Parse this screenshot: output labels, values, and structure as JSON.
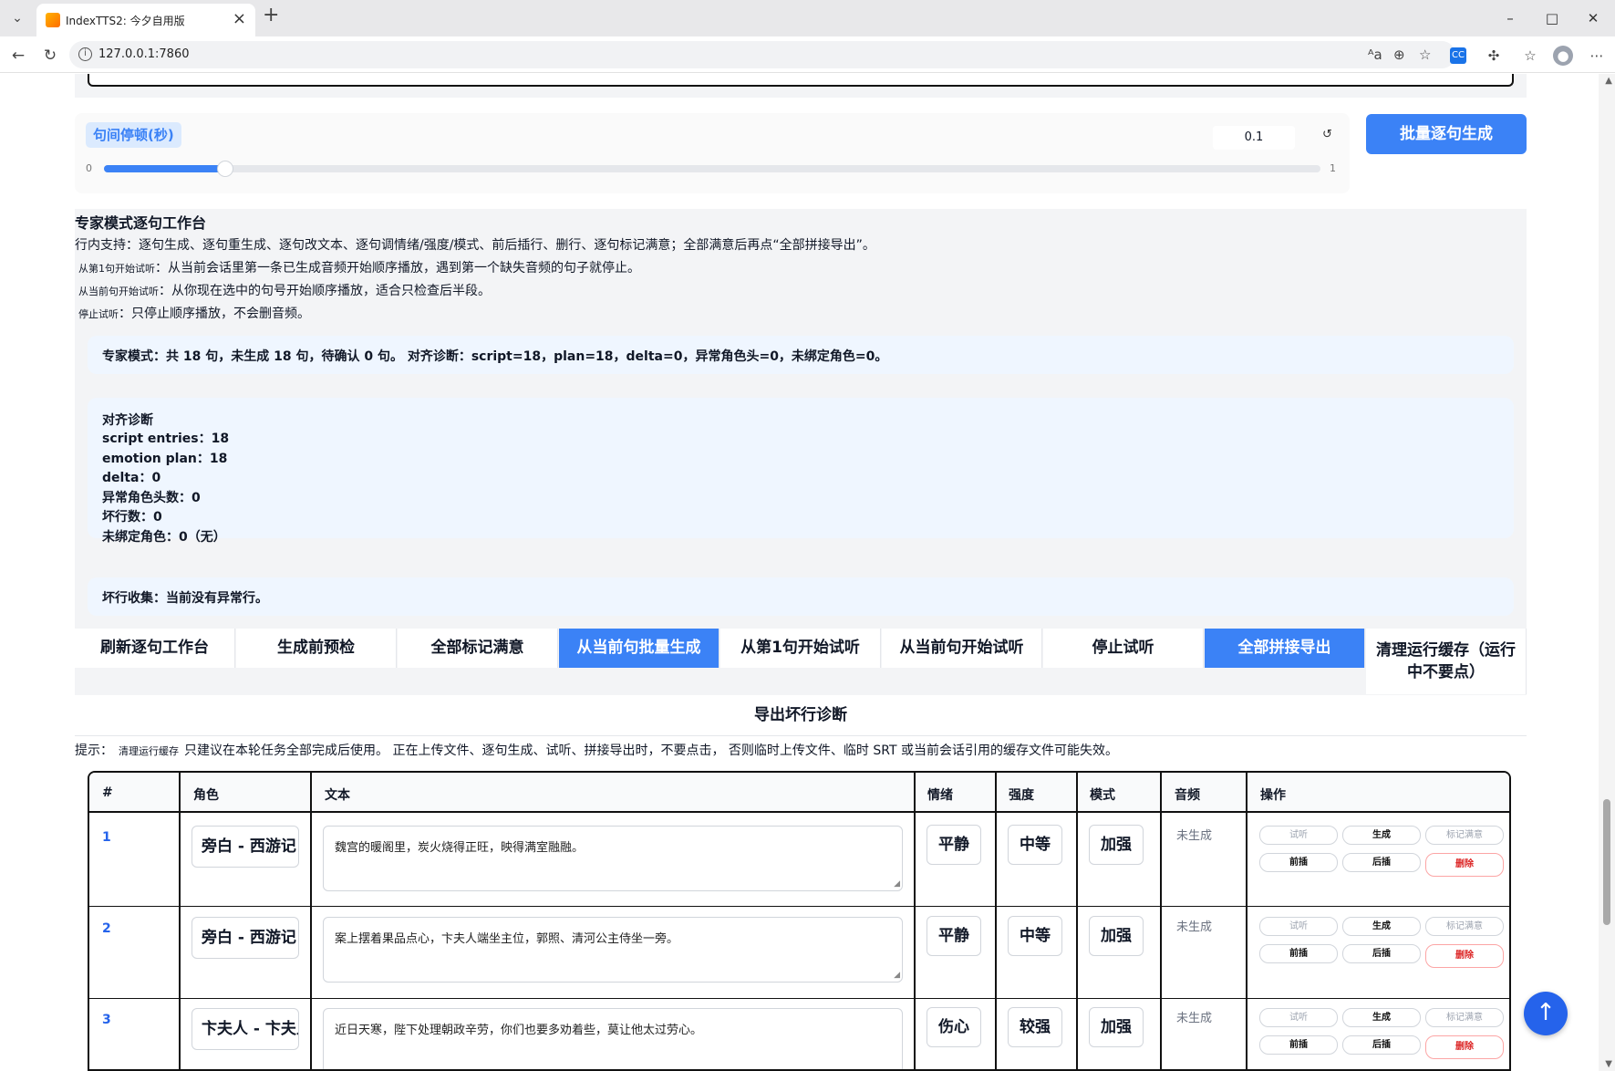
{
  "browser": {
    "tab_title": "IndexTTS2: 今夕自用版",
    "url": "127.0.0.1:7860"
  },
  "pause": {
    "label": "句间停顿(秒)",
    "value": "0.1",
    "min": "0",
    "max": "1",
    "fraction": 0.1
  },
  "batch_button": "批量逐句生成",
  "workbench": {
    "title": "专家模式逐句工作台",
    "desc": "行内支持：逐句生成、逐句重生成、逐句改文本、逐句调情绪/强度/模式、前后插行、删行、逐句标记满意；全部满意后再点“全部拼接导出”。",
    "help": [
      {
        "key": "从第1句开始试听",
        "text": "：从当前会话里第一条已生成音频开始顺序播放，遇到第一个缺失音频的句子就停止。"
      },
      {
        "key": "从当前句开始试听",
        "text": "：从你现在选中的句号开始顺序播放，适合只检查后半段。"
      },
      {
        "key": "停止试听",
        "text": "：只停止顺序播放，不会删音频。"
      }
    ],
    "status": "专家模式：共 18 句，未生成 18 句，待确认 0 句。 对齐诊断：script=18，plan=18，delta=0，异常角色头=0，未绑定角色=0。",
    "diag_title": "对齐诊断",
    "diag_lines": [
      "script entries：18",
      "emotion plan：18",
      "delta：0",
      "异常角色头数：0",
      "坏行数：0",
      "未绑定角色：0（无）"
    ],
    "bad_rows": "坏行收集：当前没有异常行。"
  },
  "actions": [
    {
      "label": "刷新逐句工作台",
      "primary": false
    },
    {
      "label": "生成前预检",
      "primary": false
    },
    {
      "label": "全部标记满意",
      "primary": false
    },
    {
      "label": "从当前句批量生成",
      "primary": true
    },
    {
      "label": "从第1句开始试听",
      "primary": false
    },
    {
      "label": "从当前句开始试听",
      "primary": false
    },
    {
      "label": "停止试听",
      "primary": false
    },
    {
      "label": "全部拼接导出",
      "primary": true
    },
    {
      "label": "清理运行缓存（运行中不要点）",
      "primary": false
    }
  ],
  "export_diag": "导出坏行诊断",
  "tip": {
    "prefix": "提示：",
    "key": "清理运行缓存",
    "text": "只建议在本轮任务全部完成后使用。 正在上传文件、逐句生成、试听、拼接导出时，不要点击， 否则临时上传文件、临时 SRT 或当前会话引用的缓存文件可能失效。"
  },
  "table": {
    "headers": [
      "#",
      "角色",
      "文本",
      "情绪",
      "强度",
      "模式",
      "音频",
      "操作"
    ],
    "op_labels": {
      "listen": "试听",
      "gen": "生成",
      "mark": "标记满意",
      "ins_before": "前插",
      "ins_after": "后插",
      "del": "删除"
    },
    "rows": [
      {
        "num": "1",
        "role": "旁白 - 西游记",
        "text": "魏宫的暖阁里，炭火烧得正旺，映得满室融融。",
        "emotion": "平静",
        "intensity": "中等",
        "mode": "加强",
        "audio": "未生成"
      },
      {
        "num": "2",
        "role": "旁白 - 西游记",
        "text": "案上摆着果品点心，卞夫人端坐主位，郭照、清河公主侍坐一旁。",
        "emotion": "平静",
        "intensity": "中等",
        "mode": "加强",
        "audio": "未生成"
      },
      {
        "num": "3",
        "role": "卞夫人 - 卞夫人",
        "text": "近日天寒，陛下处理朝政辛劳，你们也要多劝着些，莫让他太过劳心。",
        "emotion": "伤心",
        "intensity": "较强",
        "mode": "加强",
        "audio": "未生成"
      }
    ]
  },
  "colors": {
    "accent": "#3b82f6",
    "danger": "#dc2626"
  }
}
